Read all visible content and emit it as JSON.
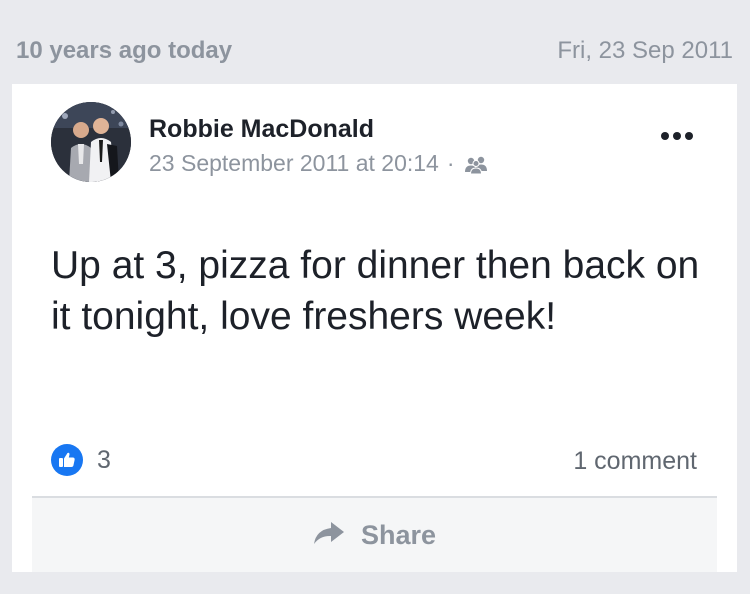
{
  "memory": {
    "when": "10 years ago today",
    "date": "Fri, 23 Sep 2011"
  },
  "post": {
    "author": "Robbie MacDonald",
    "timestamp": "23 September 2011 at 20:14",
    "separator": "·",
    "audience_icon": "friends-icon",
    "more_icon": "more-options-icon",
    "text": "Up at 3, pizza for dinner then back on it tonight, love freshers week!",
    "reaction_icon": "like-icon",
    "reaction_count": "3",
    "comment_count": "1 comment",
    "share_label": "Share",
    "share_icon": "share-arrow-icon"
  },
  "colors": {
    "background": "#e9eaee",
    "card": "#ffffff",
    "like_blue": "#1877f2",
    "muted_text": "#8d949e",
    "primary_text": "#1d2129"
  }
}
